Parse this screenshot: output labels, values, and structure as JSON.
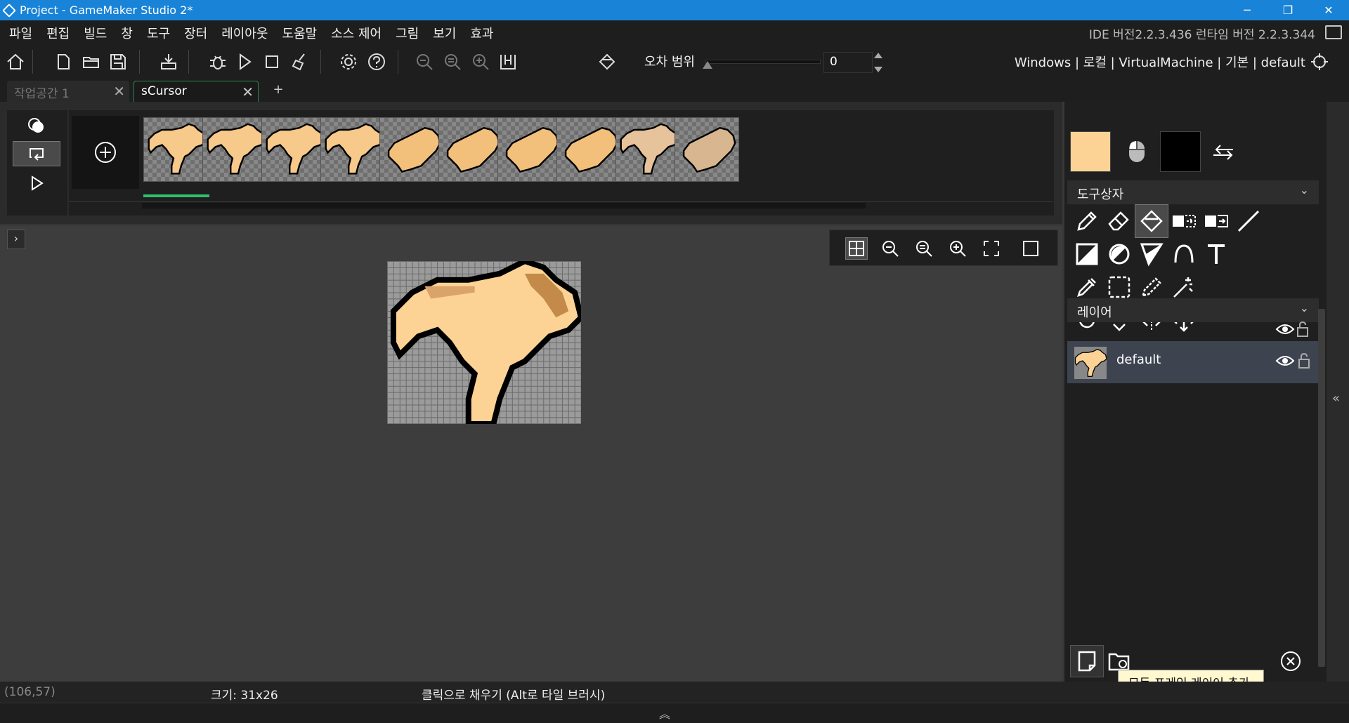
{
  "window": {
    "title": "Project - GameMaker Studio 2*",
    "minimize": "─",
    "restore": "❐",
    "close": "✕"
  },
  "menu": {
    "items": [
      "파일",
      "편집",
      "빌드",
      "창",
      "도구",
      "장터",
      "레이아웃",
      "도움말",
      "소스 제어",
      "그림",
      "보기",
      "효과"
    ],
    "ide_version": "IDE 버전2.2.3.436 런타임 버전 2.2.3.344"
  },
  "toolbar": {
    "tolerance_label": "오차 범위",
    "tolerance_value": "0",
    "target": "Windows | 로컬 | VirtualMachine | 기본 | default"
  },
  "tabs": [
    {
      "label": "작업공간 1",
      "close": "✕"
    },
    {
      "label": "sCursor",
      "close": "✕"
    }
  ],
  "tab_add": "+",
  "frames": {
    "count": 10,
    "selected_index": 0,
    "fills": [
      "#f7c98a",
      "#f7c98a",
      "#f7c98a",
      "#f7c98a",
      "#f3c07c",
      "#f3c07c",
      "#f3c07c",
      "#f3c07c",
      "#e6c39a",
      "#d8b690"
    ]
  },
  "canvas": {
    "expand": "›"
  },
  "right_panel": {
    "primary_color": "#fcd394",
    "secondary_color": "#000000",
    "toolbox_header": "도구상자",
    "layers_header": "레이어",
    "layer_name": "default",
    "chevron": "⌄"
  },
  "tooltip": "모든 프레임 레이어 추가",
  "status": {
    "coords": "(106,57)",
    "size": "크기: 31x26",
    "hint": "클릭으로 채우기 (Alt로 타일 브러시)"
  },
  "bottom_toggle": "︽",
  "side_collapse": "«"
}
